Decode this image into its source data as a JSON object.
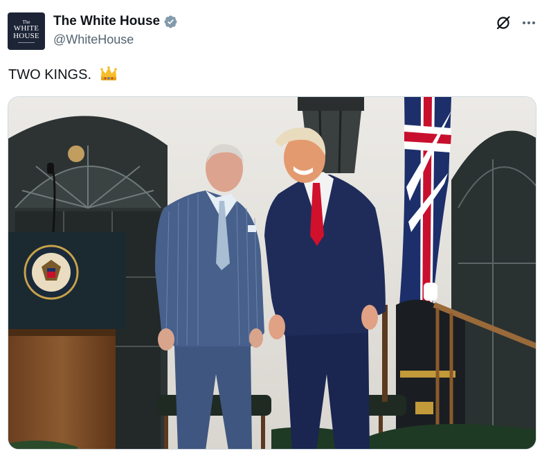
{
  "account": {
    "display_name": "The White House",
    "handle": "@WhiteHouse",
    "verified": true,
    "avatar_logo": {
      "small": "The",
      "line1": "WHITE",
      "line2": "HOUSE"
    }
  },
  "tweet": {
    "text": "TWO KINGS.",
    "emoji": "crown"
  },
  "icons": [
    "avatar-logo",
    "verified-badge-icon",
    "grok-icon",
    "more-icon",
    "crown-emoji-icon"
  ],
  "media": {
    "type": "photo",
    "scene": "two men standing beside a presidential podium with a Union flag"
  },
  "colors": {
    "verified_badge": "#829aab",
    "text_primary": "#0f1419",
    "text_secondary": "#536471",
    "avatar_bg": "#1c2436"
  }
}
